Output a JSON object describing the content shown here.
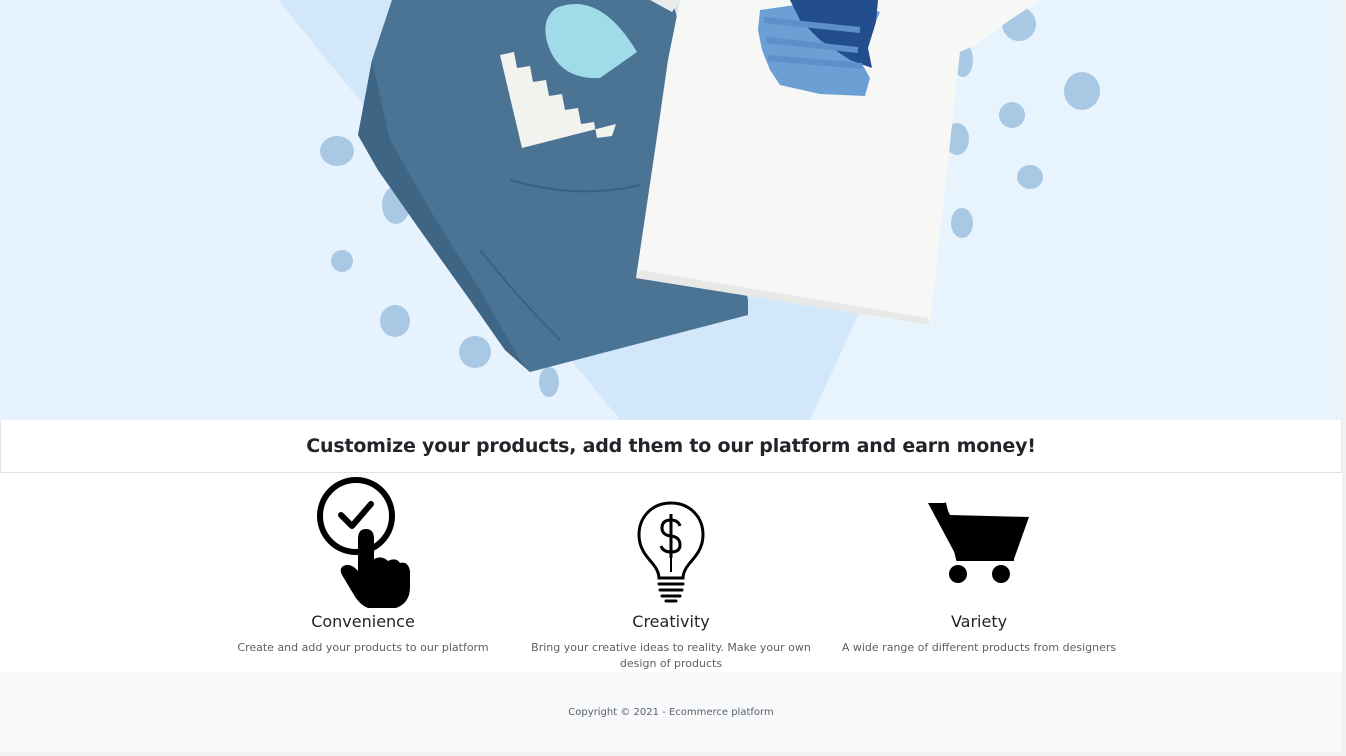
{
  "hero": {
    "image_name": "hoodie-and-tshirt-product-image"
  },
  "tagline": "Customize your products, add them to our platform and earn money!",
  "features": [
    {
      "icon": "hand-pointer-check-icon",
      "title": "Convenience",
      "description": "Create and add your products to our platform"
    },
    {
      "icon": "lightbulb-dollar-icon",
      "title": "Creativity",
      "description": "Bring your creative ideas to reality. Make your own design of products"
    },
    {
      "icon": "shopping-cart-icon",
      "title": "Variety",
      "description": "A wide range of different products from designers"
    }
  ],
  "footer": {
    "copyright": "Copyright © 2021 - Ecommerce platform"
  },
  "colors": {
    "hero_background": "#e8f4fd",
    "hoodie": "#4b7393",
    "tshirt": "#f7f7f5",
    "dots": "#a9c8e4",
    "footer_background": "#f8f9fa"
  }
}
